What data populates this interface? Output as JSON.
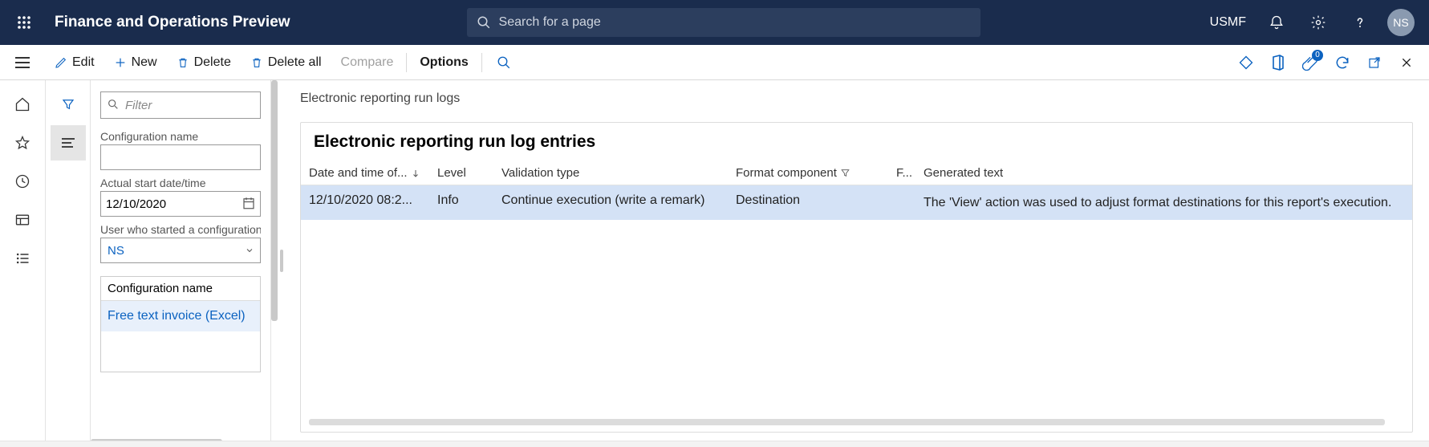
{
  "header": {
    "app_title": "Finance and Operations Preview",
    "search_placeholder": "Search for a page",
    "company": "USMF",
    "avatar_initials": "NS",
    "attachment_count": "0"
  },
  "actions": {
    "edit": "Edit",
    "new": "New",
    "delete": "Delete",
    "delete_all": "Delete all",
    "compare": "Compare",
    "options": "Options"
  },
  "sidepanel": {
    "filter_placeholder": "Filter",
    "config_name_label": "Configuration name",
    "config_name_value": "",
    "actual_start_label": "Actual start date/time",
    "actual_start_value": "12/10/2020",
    "user_label": "User who started a configuration",
    "user_value": "NS",
    "config_table_header": "Configuration name",
    "config_row": "Free text invoice (Excel)"
  },
  "main": {
    "page_title": "Electronic reporting run logs",
    "card_title": "Electronic reporting run log entries",
    "columns": {
      "datetime": "Date and time of...",
      "level": "Level",
      "validation_type": "Validation type",
      "format_component": "Format component",
      "f2": "F...",
      "generated_text": "Generated text"
    },
    "rows": [
      {
        "datetime": "12/10/2020 08:2...",
        "level": "Info",
        "validation_type": "Continue execution (write a remark)",
        "format_component": "Destination",
        "f2": "",
        "generated_text": "The 'View' action was used to adjust format destinations for this report's execution."
      }
    ]
  }
}
